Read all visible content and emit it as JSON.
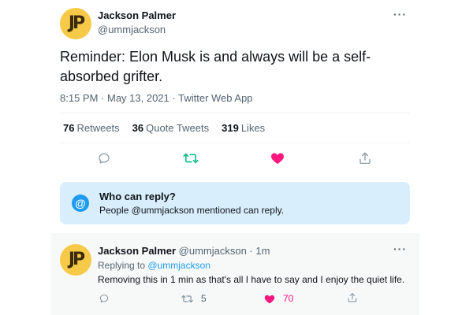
{
  "tweet": {
    "author_name": "Jackson Palmer",
    "author_handle": "@ummjackson",
    "avatar_monogram": "JP",
    "text": "Reminder: Elon Musk is and always will be a self-absorbed grifter.",
    "time": "8:15 PM",
    "date": "May 13, 2021",
    "source": "Twitter Web App",
    "more_label": "···",
    "stats": {
      "retweets_count": "76",
      "retweets_label": "Retweets",
      "quotes_count": "36",
      "quotes_label": "Quote Tweets",
      "likes_count": "319",
      "likes_label": "Likes"
    },
    "actions": [
      "reply-icon",
      "retweet-icon",
      "like-icon-filled",
      "share-icon"
    ]
  },
  "who_can_reply": {
    "icon": "@",
    "title": "Who can reply?",
    "text_prefix": "People ",
    "mention": "@ummjackson",
    "text_suffix": " mentioned can reply."
  },
  "reply": {
    "author_name": "Jackson Palmer",
    "author_handle": "@ummjackson",
    "time": "1m",
    "separator": " · ",
    "replying_to_label": "Replying to ",
    "replying_to_handle": "@ummjackson",
    "text": "Removing this in 1 min as that's all I have to say and I enjoy the quiet life.",
    "retweet_count": "5",
    "like_count": "70",
    "more_label": "···"
  },
  "colors": {
    "accent_blue": "#1d9bf0",
    "retweet_green": "#00ba7c",
    "like_pink": "#f91880",
    "secondary_text": "#536471",
    "avatar_yellow": "#f7c948"
  }
}
